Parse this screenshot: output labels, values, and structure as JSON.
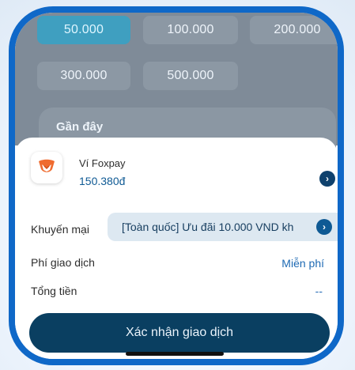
{
  "amounts": {
    "row1": [
      "50.000",
      "100.000",
      "200.000"
    ],
    "row2": [
      "300.000",
      "500.000"
    ]
  },
  "recent": {
    "title": "Gần đây"
  },
  "wallet": {
    "name": "Ví Foxpay",
    "balance": "150.380đ",
    "icon": "chevron-right-icon"
  },
  "promo": {
    "label": "Khuyến mại",
    "text": "[Toàn quốc] Ưu đãi 10.000 VND kh",
    "icon": "chevron-right-icon"
  },
  "fee": {
    "label": "Phí giao dịch",
    "value": "Miễn phí"
  },
  "total": {
    "label": "Tổng tiền",
    "value": "--"
  },
  "confirm": {
    "label": "Xác nhận giao dịch"
  },
  "colors": {
    "phone_frame": "#0f68c8",
    "primary_button": "#0a3f61",
    "balance": "#0f5a94",
    "link": "#1d69b3"
  }
}
